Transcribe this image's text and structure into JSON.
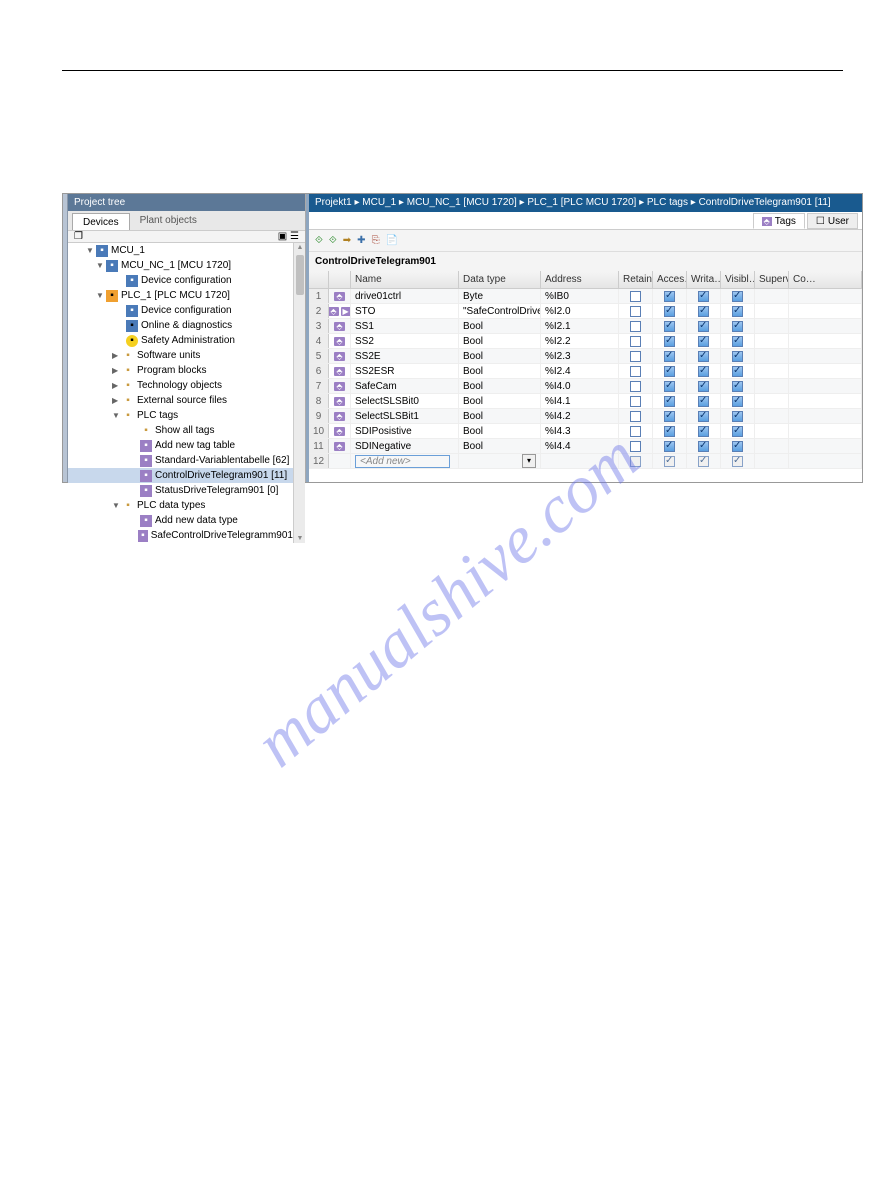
{
  "watermark": "manualshive.com",
  "projectTree": {
    "title": "Project tree",
    "tabDevices": "Devices",
    "tabPlant": "Plant objects",
    "nodes": [
      {
        "ind": 18,
        "arr": "▼",
        "ic": "dev",
        "txt": "MCU_1"
      },
      {
        "ind": 28,
        "arr": "▼",
        "ic": "dev",
        "txt": "MCU_NC_1 [MCU 1720]"
      },
      {
        "ind": 48,
        "arr": "",
        "ic": "dev",
        "txt": "Device configuration"
      },
      {
        "ind": 28,
        "arr": "▼",
        "ic": "plc",
        "txt": "PLC_1 [PLC MCU 1720]"
      },
      {
        "ind": 48,
        "arr": "",
        "ic": "dev",
        "txt": "Device configuration"
      },
      {
        "ind": 48,
        "arr": "",
        "ic": "tech",
        "txt": "Online & diagnostics"
      },
      {
        "ind": 48,
        "arr": "",
        "ic": "safe",
        "txt": "Safety Administration"
      },
      {
        "ind": 44,
        "arr": "▶",
        "ic": "fold",
        "txt": "Software units"
      },
      {
        "ind": 44,
        "arr": "▶",
        "ic": "fold",
        "txt": "Program blocks"
      },
      {
        "ind": 44,
        "arr": "▶",
        "ic": "fold",
        "txt": "Technology objects"
      },
      {
        "ind": 44,
        "arr": "▶",
        "ic": "fold",
        "txt": "External source files"
      },
      {
        "ind": 44,
        "arr": "▼",
        "ic": "tag",
        "txt": "PLC tags"
      },
      {
        "ind": 62,
        "arr": "",
        "ic": "tag",
        "txt": "Show all tags"
      },
      {
        "ind": 62,
        "arr": "",
        "ic": "tbl",
        "txt": "Add new tag table"
      },
      {
        "ind": 62,
        "arr": "",
        "ic": "tbl",
        "txt": "Standard-Variablentabelle [62]"
      },
      {
        "ind": 62,
        "arr": "",
        "ic": "tbl",
        "txt": "ControlDriveTelegram901 [11]",
        "sel": true
      },
      {
        "ind": 62,
        "arr": "",
        "ic": "tbl",
        "txt": "StatusDriveTelegram901 [0]"
      },
      {
        "ind": 44,
        "arr": "▼",
        "ic": "fold",
        "txt": "PLC data types"
      },
      {
        "ind": 62,
        "arr": "",
        "ic": "tbl",
        "txt": "Add new data type"
      },
      {
        "ind": 62,
        "arr": "",
        "ic": "tbl",
        "txt": "SafeControlDriveTelegramm901"
      }
    ]
  },
  "breadcrumb": "Projekt1  ▸  MCU_1  ▸  MCU_NC_1 [MCU 1720]  ▸  PLC_1 [PLC MCU 1720]  ▸  PLC tags  ▸  ControlDriveTelegram901 [11]",
  "subtabs": {
    "tags": "Tags",
    "user": "User"
  },
  "paneTitle": "ControlDriveTelegram901",
  "headers": {
    "name": "Name",
    "dt": "Data type",
    "adr": "Address",
    "ret": "Retain",
    "acc": "Acces…",
    "wri": "Writa…",
    "vis": "Visibl…",
    "sup": "Supervis…",
    "co": "Co…"
  },
  "rows": [
    {
      "n": "1",
      "name": "drive01ctrl",
      "dt": "Byte",
      "adr": "%IB0",
      "acc": true,
      "wri": true,
      "vis": true,
      "sup": false
    },
    {
      "n": "2",
      "name": "STO",
      "dt": "\"SafeControlDriveTel…",
      "adr": "%I2.0",
      "acc": true,
      "wri": true,
      "vis": true,
      "sup": false,
      "exp": "▶"
    },
    {
      "n": "3",
      "name": "SS1",
      "dt": "Bool",
      "adr": "%I2.1",
      "acc": true,
      "wri": true,
      "vis": true,
      "sup": false
    },
    {
      "n": "4",
      "name": "SS2",
      "dt": "Bool",
      "adr": "%I2.2",
      "acc": true,
      "wri": true,
      "vis": true,
      "sup": false
    },
    {
      "n": "5",
      "name": "SS2E",
      "dt": "Bool",
      "adr": "%I2.3",
      "acc": true,
      "wri": true,
      "vis": true,
      "sup": false
    },
    {
      "n": "6",
      "name": "SS2ESR",
      "dt": "Bool",
      "adr": "%I2.4",
      "acc": true,
      "wri": true,
      "vis": true,
      "sup": false
    },
    {
      "n": "7",
      "name": "SafeCam",
      "dt": "Bool",
      "adr": "%I4.0",
      "acc": true,
      "wri": true,
      "vis": true,
      "sup": false
    },
    {
      "n": "8",
      "name": "SelectSLSBit0",
      "dt": "Bool",
      "adr": "%I4.1",
      "acc": true,
      "wri": true,
      "vis": true,
      "sup": false
    },
    {
      "n": "9",
      "name": "SelectSLSBit1",
      "dt": "Bool",
      "adr": "%I4.2",
      "acc": true,
      "wri": true,
      "vis": true,
      "sup": false
    },
    {
      "n": "10",
      "name": "SDIPosistive",
      "dt": "Bool",
      "adr": "%I4.3",
      "acc": true,
      "wri": true,
      "vis": true,
      "sup": false
    },
    {
      "n": "11",
      "name": "SDINegative",
      "dt": "Bool",
      "adr": "%I4.4",
      "acc": true,
      "wri": true,
      "vis": true,
      "sup": false
    }
  ],
  "addnew": "<Add new>"
}
